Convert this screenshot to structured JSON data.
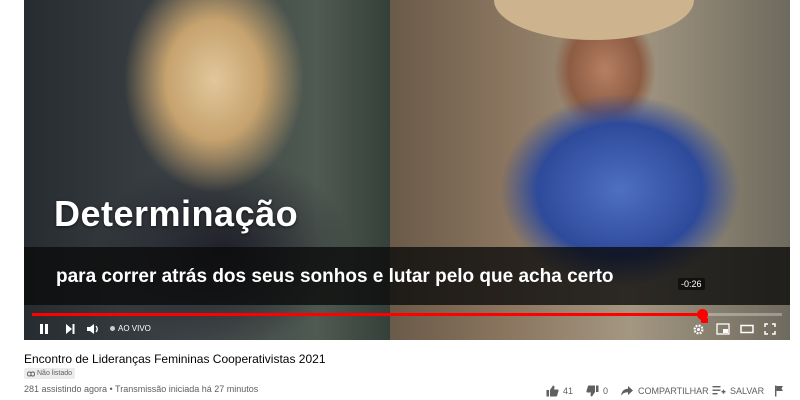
{
  "player": {
    "caption_title": "Determinação",
    "caption_subtitle": "para correr atrás dos seus sonhos e lutar pelo que acha certo",
    "time_tooltip": "-0:26",
    "progress_fraction": 0.893,
    "live_label": "AO VIVO",
    "progress_color": "#ff0000"
  },
  "video": {
    "title": "Encontro de Lideranças Femininas Cooperativistas 2021",
    "visibility_badge": "Não listado",
    "meta": "281 assistindo agora • Transmissão iniciada há 27 minutos"
  },
  "actions": {
    "like_count": "41",
    "dislike_count": "0",
    "share_label": "COMPARTILHAR",
    "save_label": "SALVAR"
  },
  "icons": {
    "play_pause": "pause-icon",
    "next": "next-icon",
    "volume": "volume-icon",
    "settings": "gear-icon",
    "miniplayer": "miniplayer-icon",
    "theater": "theater-icon",
    "fullscreen": "fullscreen-icon",
    "like": "thumbs-up-icon",
    "dislike": "thumbs-down-icon",
    "share": "share-icon",
    "save": "save-playlist-icon",
    "report": "flag-icon"
  }
}
